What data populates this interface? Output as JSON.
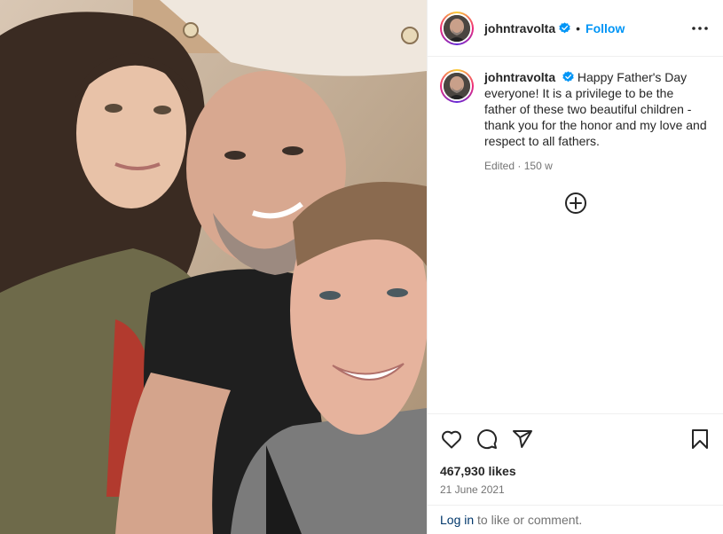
{
  "post": {
    "username": "johntravolta",
    "verified": true,
    "follow_label": "Follow",
    "separator": "•"
  },
  "caption": {
    "username": "johntravolta",
    "text": "Happy Father's Day everyone! It is a privilege to be the father of these two beautiful children - thank you for the honor and my love and respect to all fathers.",
    "edited_label": "Edited",
    "meta_separator": "·",
    "age": "150 w"
  },
  "engagement": {
    "likes": "467,930 likes",
    "date": "21 June 2021"
  },
  "login": {
    "link_label": "Log in",
    "rest_text": " to like or comment."
  },
  "colors": {
    "accent": "#0095f6",
    "verified": "#0095f6",
    "link_dark": "#00376b",
    "muted": "#737373",
    "border": "#efefef"
  },
  "icons": {
    "verified": "verified-badge-icon",
    "more": "more-options-icon",
    "load_more": "plus-circle-icon",
    "like": "heart-icon",
    "comment": "comment-icon",
    "share": "share-icon",
    "save": "bookmark-icon"
  }
}
